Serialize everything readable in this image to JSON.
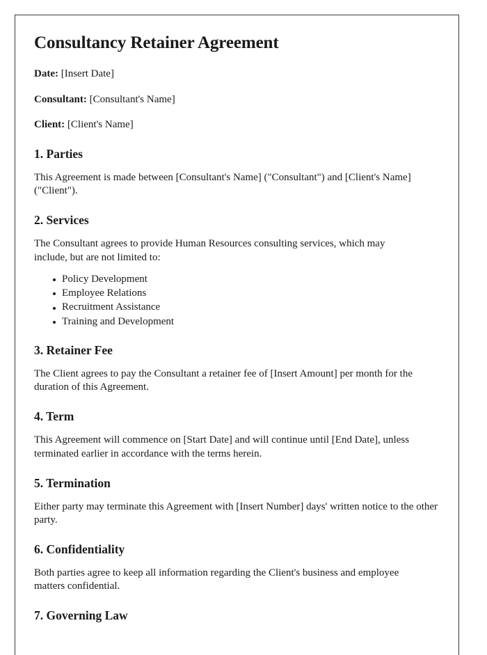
{
  "document": {
    "title": "Consultancy Retainer Agreement",
    "meta": [
      {
        "label": "Date:",
        "value": "[Insert Date]"
      },
      {
        "label": "Consultant:",
        "value": "[Consultant's Name]"
      },
      {
        "label": "Client:",
        "value": "[Client's Name]"
      }
    ],
    "sections": [
      {
        "heading": "1. Parties",
        "body": "This Agreement is made between [Consultant's Name] (\"Consultant\") and [Client's Name] (\"Client\")."
      },
      {
        "heading": "2. Services",
        "body": "The Consultant agrees to provide Human Resources consulting services, which may include, but are not limited to:",
        "bullets": [
          "Policy Development",
          "Employee Relations",
          "Recruitment Assistance",
          "Training and Development"
        ]
      },
      {
        "heading": "3. Retainer Fee",
        "body": "The Client agrees to pay the Consultant a retainer fee of [Insert Amount] per month for the duration of this Agreement."
      },
      {
        "heading": "4. Term",
        "body": "This Agreement will commence on [Start Date] and will continue until [End Date], unless terminated earlier in accordance with the terms herein."
      },
      {
        "heading": "5. Termination",
        "body": "Either party may terminate this Agreement with [Insert Number] days' written notice to the other party."
      },
      {
        "heading": "6. Confidentiality",
        "body": "Both parties agree to keep all information regarding the Client's business and employee matters confidential."
      },
      {
        "heading": "7. Governing Law"
      }
    ]
  }
}
